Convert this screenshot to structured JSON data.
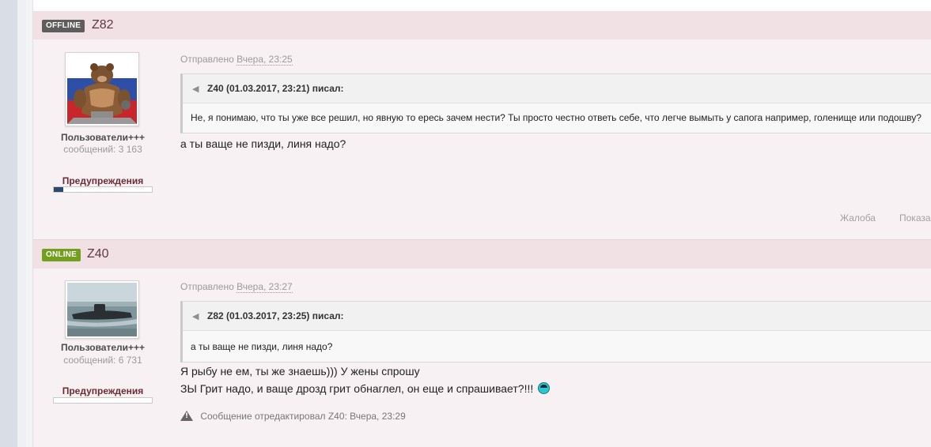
{
  "posts": [
    {
      "status": "OFFLINE",
      "status_color": "#5d5d5d",
      "username": "Z82",
      "group": "Пользователи+++",
      "post_count": "сообщений: 3 163",
      "warnings_label": "Предупреждения",
      "warning_level": 0.1,
      "sent_prefix": "Отправлено",
      "sent_date": "Вчера, 23:25",
      "quote": {
        "header": "Z40 (01.03.2017, 23:21) писал:",
        "text": "Не, я понимаю, что ты уже все решил, но явную то ересь зачем нести? Ты просто честно ответь себе, что легче вымыть у сапога например, голенище или подошву?"
      },
      "body_lines": [
        "а ты ваще не пизди, линя надо?"
      ],
      "footer": {
        "report": "Жалоба",
        "show": "Показа"
      }
    },
    {
      "status": "ONLINE",
      "status_color": "#72a01e",
      "username": "Z40",
      "group": "Пользователи+++",
      "post_count": "сообщений: 6 731",
      "warnings_label": "Предупреждения",
      "warning_level": 0,
      "sent_prefix": "Отправлено",
      "sent_date": "Вчера, 23:27",
      "quote": {
        "header": "Z82 (01.03.2017, 23:25) писал:",
        "text": "а ты ваще не пизди, линя надо?"
      },
      "body_lines": [
        "Я рыбу не ем, ты же знаешь))) У жены спрошу",
        "ЗЫ Грит надо, и ваще дрозд грит обнаглел, он еще и спрашивает?!!!"
      ],
      "edit_note": "Сообщение отредактировал Z40: Вчера, 23:29"
    }
  ]
}
